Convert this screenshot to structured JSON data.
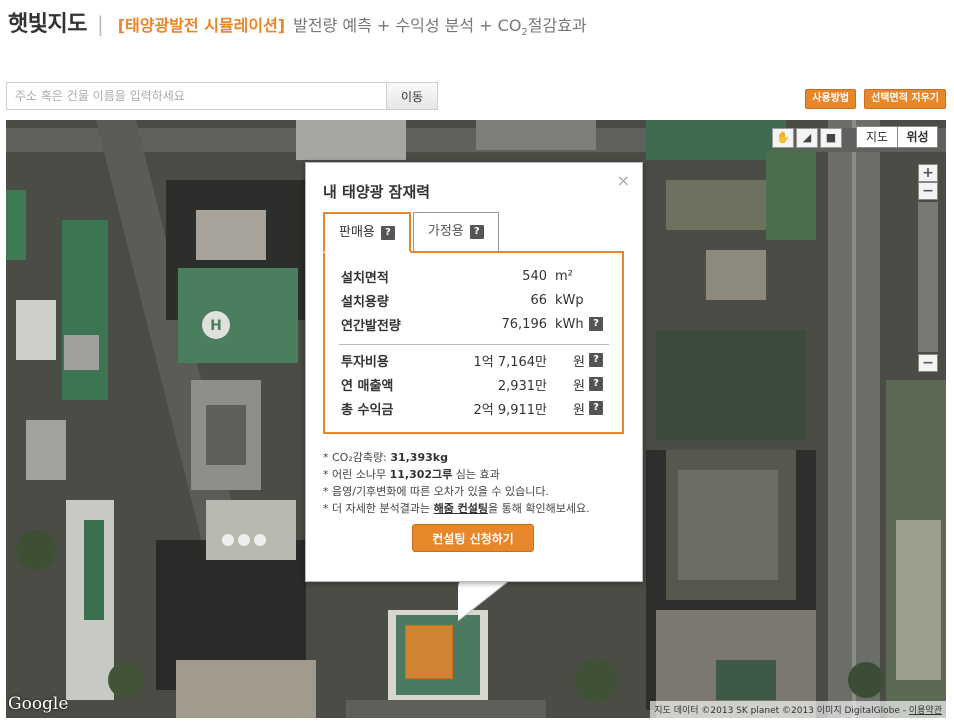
{
  "header": {
    "brand": "햇빛지도",
    "separator": "|",
    "subtitle_accent": "[태양광발전 시뮬레이션]",
    "subtitle_rest_a": "발전량 예측 + 수익성 분석 + CO",
    "subtitle_sub": "2",
    "subtitle_rest_b": "절감효과"
  },
  "search": {
    "placeholder": "주소 혹은 건물 이름을 입력하세요",
    "value": "",
    "button_label": "이동"
  },
  "top_buttons": {
    "help": "사용방법",
    "clear_selection": "선택면적 지우기"
  },
  "map": {
    "type_map": "지도",
    "type_satellite": "위성",
    "active_type": "위성",
    "zoom_in": "+",
    "zoom_out": "−",
    "logo": "Google",
    "copyright": "지도 데이터 ©2013 SK planet ©2013 이미지 DigitalGlobe -",
    "terms_link": "이용약관",
    "tool_icons": [
      "hand-icon",
      "polygon-draw-icon",
      "rectangle-draw-icon"
    ]
  },
  "popup": {
    "title": "내 태양광 잠재력",
    "close": "×",
    "tabs": [
      {
        "label": "판매용",
        "active": true
      },
      {
        "label": "가정용",
        "active": false
      }
    ],
    "rows": [
      {
        "label": "설치면적",
        "value": "540",
        "unit": "m²",
        "help": false
      },
      {
        "label": "설치용량",
        "value": "66",
        "unit": "kWp",
        "help": false
      },
      {
        "label": "연간발전량",
        "value": "76,196",
        "unit": "kWh",
        "help": true
      },
      {
        "label": "투자비용",
        "value": "1억 7,164만",
        "unit": "원",
        "help": true
      },
      {
        "label": "연 매출액",
        "value": "2,931만",
        "unit": "원",
        "help": true
      },
      {
        "label": "총 수익금",
        "value": "2억 9,911만",
        "unit": "원",
        "help": true
      }
    ],
    "help_mark": "?",
    "notes": {
      "co2_prefix": "* CO₂감축량: ",
      "co2_value": "31,393kg",
      "trees_prefix": "* 어린 소나무 ",
      "trees_value": "11,302그루",
      "trees_suffix": " 심는 효과",
      "disclaimer": "* 음영/기후변화에 따른 오차가 있을 수 있습니다.",
      "detail_prefix": "* 더 자세한 분석결과는 ",
      "detail_link": "해줌 컨설팅",
      "detail_suffix": "을 통해 확인해보세요."
    },
    "consult_button": "컨설팅 신청하기"
  },
  "colors": {
    "accent": "#e8862a",
    "text": "#333333"
  }
}
